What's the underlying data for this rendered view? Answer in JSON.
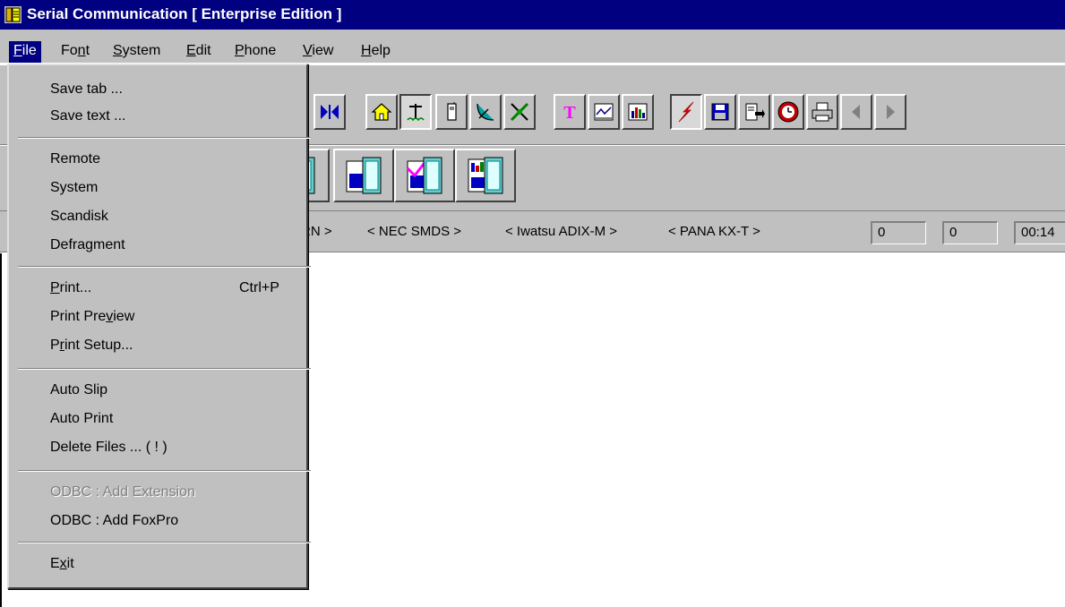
{
  "window": {
    "title": "Serial Communication [ Enterprise Edition ]"
  },
  "menubar": {
    "items": [
      {
        "label": "File",
        "mnemonic": "F",
        "rest": "ile",
        "active": true
      },
      {
        "label": "Font",
        "pre": "Fo",
        "mnemonic": "n",
        "rest": "t"
      },
      {
        "label": "System",
        "mnemonic": "S",
        "rest": "ystem"
      },
      {
        "label": "Edit",
        "mnemonic": "E",
        "rest": "dit"
      },
      {
        "label": "Phone",
        "mnemonic": "P",
        "rest": "hone"
      },
      {
        "label": "View",
        "mnemonic": "V",
        "rest": "iew"
      },
      {
        "label": "Help",
        "mnemonic": "H",
        "rest": "elp"
      }
    ]
  },
  "file_menu": {
    "items": [
      {
        "label": "Save tab ..."
      },
      {
        "label": "Save text ..."
      },
      {
        "label": "Remote"
      },
      {
        "label": "System"
      },
      {
        "label": "Scandisk"
      },
      {
        "label": "Defragment"
      },
      {
        "label": "Print...",
        "shortcut": "Ctrl+P"
      },
      {
        "label": "Print Preview"
      },
      {
        "label": "Print Setup..."
      },
      {
        "label": "Auto Slip"
      },
      {
        "label": "Auto Print"
      },
      {
        "label": "Delete  Files ... ( ! )"
      },
      {
        "label": "ODBC : Add Extension",
        "disabled": true
      },
      {
        "label": "ODBC : Add FoxPro"
      },
      {
        "label": "Exit"
      }
    ]
  },
  "toolbar": {
    "icons": [
      "split-icon",
      "home-icon",
      "antenna-icon",
      "phone-icon",
      "satellite-dish-icon",
      "satellite-icon",
      "text-icon",
      "line-chart-icon",
      "bar-chart-icon",
      "lightning-icon",
      "save-icon",
      "export-icon",
      "clock-icon",
      "printer-icon",
      "arrow-left-icon",
      "arrow-right-icon"
    ],
    "large_icons": [
      "document-stack-icon",
      "document-table-icon",
      "document-lines-icon",
      "document-check-icon",
      "document-chart-icon"
    ]
  },
  "status": {
    "pbx_labels": [
      "RN >",
      "< NEC SMDS >",
      "< Iwatsu ADIX-M >",
      "< PANA KX-T >"
    ],
    "field1": "0",
    "field2": "0",
    "time": "00:14"
  },
  "colors": {
    "titlebar": "#000080",
    "face": "#c0c0c0",
    "highlight": "#000080"
  }
}
